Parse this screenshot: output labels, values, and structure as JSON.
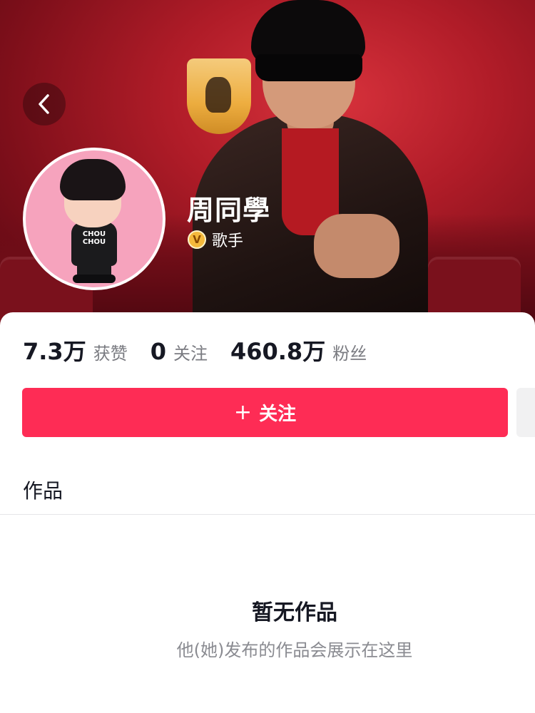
{
  "profile": {
    "name": "周同學",
    "verify_badge": "V",
    "verify_label": "歌手"
  },
  "stats": [
    {
      "value": "7.3万",
      "label": "获赞"
    },
    {
      "value": "0",
      "label": "关注"
    },
    {
      "value": "460.8万",
      "label": "粉丝"
    }
  ],
  "avatar_shirt_text": "CHOU CHOU",
  "actions": {
    "follow_icon": "+",
    "follow_label": "关注"
  },
  "tabs": {
    "works_label": "作品"
  },
  "empty_state": {
    "title": "暂无作品",
    "subtitle": "他(她)发布的作品会展示在这里"
  },
  "colors": {
    "accent": "#fe2c55",
    "banner": "#b01c28",
    "avatar_bg": "#f6a3bd",
    "verify_gold": "#f5b93c"
  },
  "icons": {
    "back": "chevron-left-icon",
    "verify": "verified-badge-icon",
    "follow": "plus-icon"
  }
}
